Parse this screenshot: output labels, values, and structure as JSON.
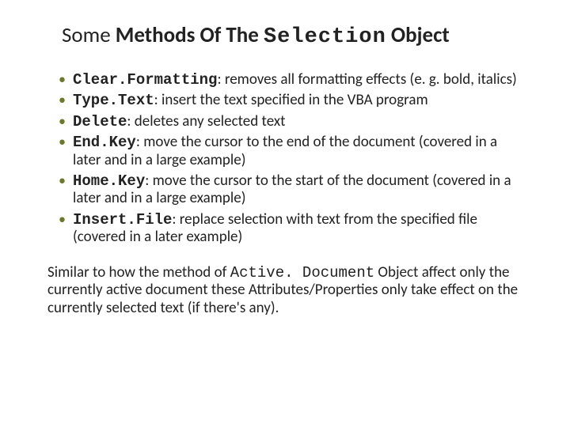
{
  "title": {
    "pre": "Some ",
    "mid_bold": "Methods Of The ",
    "code_word": "Selection",
    "post_bold": " Object"
  },
  "methods": [
    {
      "name": "Clear.Formatting",
      "desc": ": removes all formatting effects (e. g. bold, italics)"
    },
    {
      "name": "Type.Text",
      "desc": ": insert the text specified in the VBA program"
    },
    {
      "name": "Delete",
      "desc": ": deletes any selected text"
    },
    {
      "name": "End.Key",
      "desc": ": move the cursor to the end of the document (covered in a later and in a large example)"
    },
    {
      "name": "Home.Key",
      "desc": ": move the cursor to the start of the document (covered in a later and in a large example)"
    },
    {
      "name": "Insert.File",
      "desc": ": replace selection with text from the specified file (covered in a later example)"
    }
  ],
  "footer": {
    "pre": "Similar to how the method of ",
    "code": "Active. Document",
    "post": " Object affect only the currently active document these Attributes/Properties only take effect on the currently selected text (if there's any)."
  }
}
